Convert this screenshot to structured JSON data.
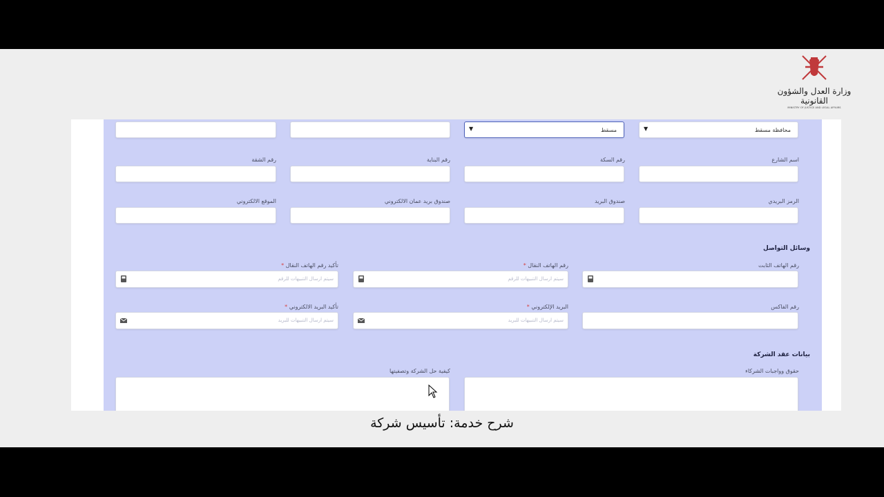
{
  "branding": {
    "name_ar": "وزارة العدل والشؤون القانونية",
    "name_en": "MINISTRY OF JUSTICE AND LEGAL AFFAIRS"
  },
  "colors": {
    "form_background": "#ccd1f7",
    "required": "#d64444"
  },
  "address": {
    "governorate": "محافظة مسقط",
    "wilayat": "مسقط",
    "street_label": "اسم الشارع",
    "way_label": "رقم السكة",
    "building_label": "رقم البناية",
    "flat_label": "رقم الشقة",
    "postal_code_label": "الرمز البريدي",
    "po_box_label": "صندوق البريد",
    "oman_post_label": "صندوق بريد عمان الالكتروني",
    "website_label": "الموقع الالكتروني"
  },
  "contact": {
    "title": "وسائل التواصل",
    "landline_label": "رقم الهاتف الثابت",
    "mobile_label": "رقم الهاتف النقال",
    "mobile_confirm_label": "تأكيد رقم الهاتف النقال",
    "mobile_placeholder": "سيتم ارسال التنبيهات للرقم",
    "fax_label": "رقم الفاكس",
    "email_label": "البريد الإلكتروني",
    "email_confirm_label": "تأكيد البريد الالكتروني",
    "email_placeholder": "سيتم ارسال التنبيهات للبريد",
    "required_mark": "*"
  },
  "contract": {
    "title": "بيانات عقد الشركة",
    "rights_label": "حقوق وواجبات الشركاء",
    "dissolution_label": "كيفية حل الشركة وتصفيتها"
  },
  "caption": "شرح خدمة: تأسيس شركة"
}
